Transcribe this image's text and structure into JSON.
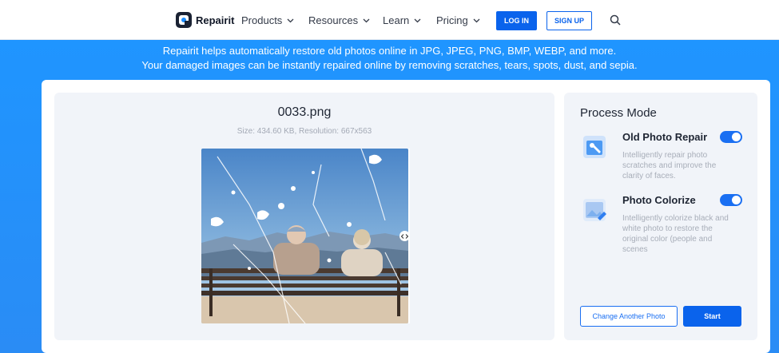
{
  "nav": {
    "brand": "Repairit",
    "items": [
      {
        "label": "Products"
      },
      {
        "label": "Resources"
      },
      {
        "label": "Learn"
      },
      {
        "label": "Pricing"
      }
    ],
    "login_label": "LOG IN",
    "signup_label": "SIGN UP"
  },
  "hero": {
    "line1": "Repairit helps automatically restore old photos online in JPG, JPEG, PNG, BMP, WEBP, and more.",
    "line2": "Your damaged images can be instantly repaired online by removing scratches, tears, spots, dust, and sepia."
  },
  "preview": {
    "file_name": "0033.png",
    "meta": "Size: 434.60 KB, Resolution: 667x563"
  },
  "process": {
    "title": "Process Mode",
    "modes": [
      {
        "title": "Old Photo Repair",
        "description": "Intelligently repair photo scratches and improve the clarity of faces.",
        "enabled": true
      },
      {
        "title": "Photo Colorize",
        "description": "Intelligently colorize black and white photo to restore the original color (people and scenes",
        "enabled": true
      }
    ],
    "change_label": "Change Another Photo",
    "start_label": "Start"
  },
  "colors": {
    "accent": "#0a63ec",
    "hero": "#1f95ff",
    "panel": "#f1f4f9"
  }
}
